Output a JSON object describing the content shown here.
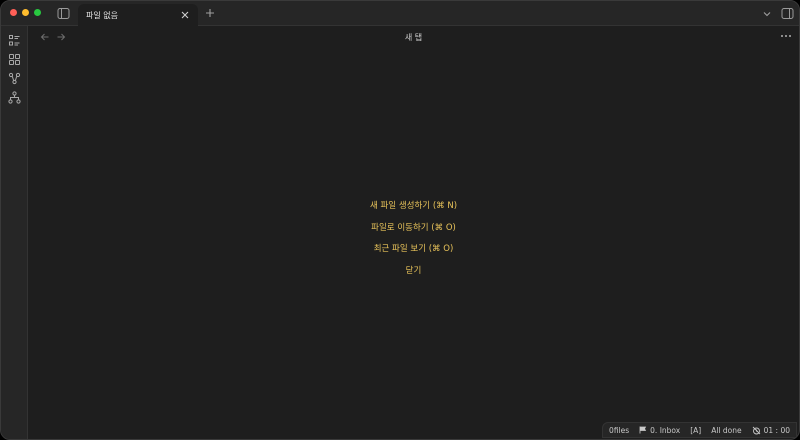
{
  "titlebar": {
    "tab_title": "파일 없음"
  },
  "view": {
    "title": "새 탭"
  },
  "empty_state": {
    "actions": [
      "새 파일 생성하기 (⌘ N)",
      "파일로 이동하기 (⌘ O)",
      "최근 파일 보기 (⌘ O)",
      "닫기"
    ]
  },
  "statusbar": {
    "files": "0files",
    "inbox": "0. Inbox",
    "mode": "[A]",
    "tasks": "All done",
    "timer": "01 : 00"
  },
  "colors": {
    "background": "#1e1e1e",
    "chrome": "#262626",
    "accent": "#e8c35a"
  },
  "icons": {
    "ribbon": [
      "list-icon",
      "grid-icon",
      "graph-icon",
      "hierarchy-icon"
    ]
  }
}
